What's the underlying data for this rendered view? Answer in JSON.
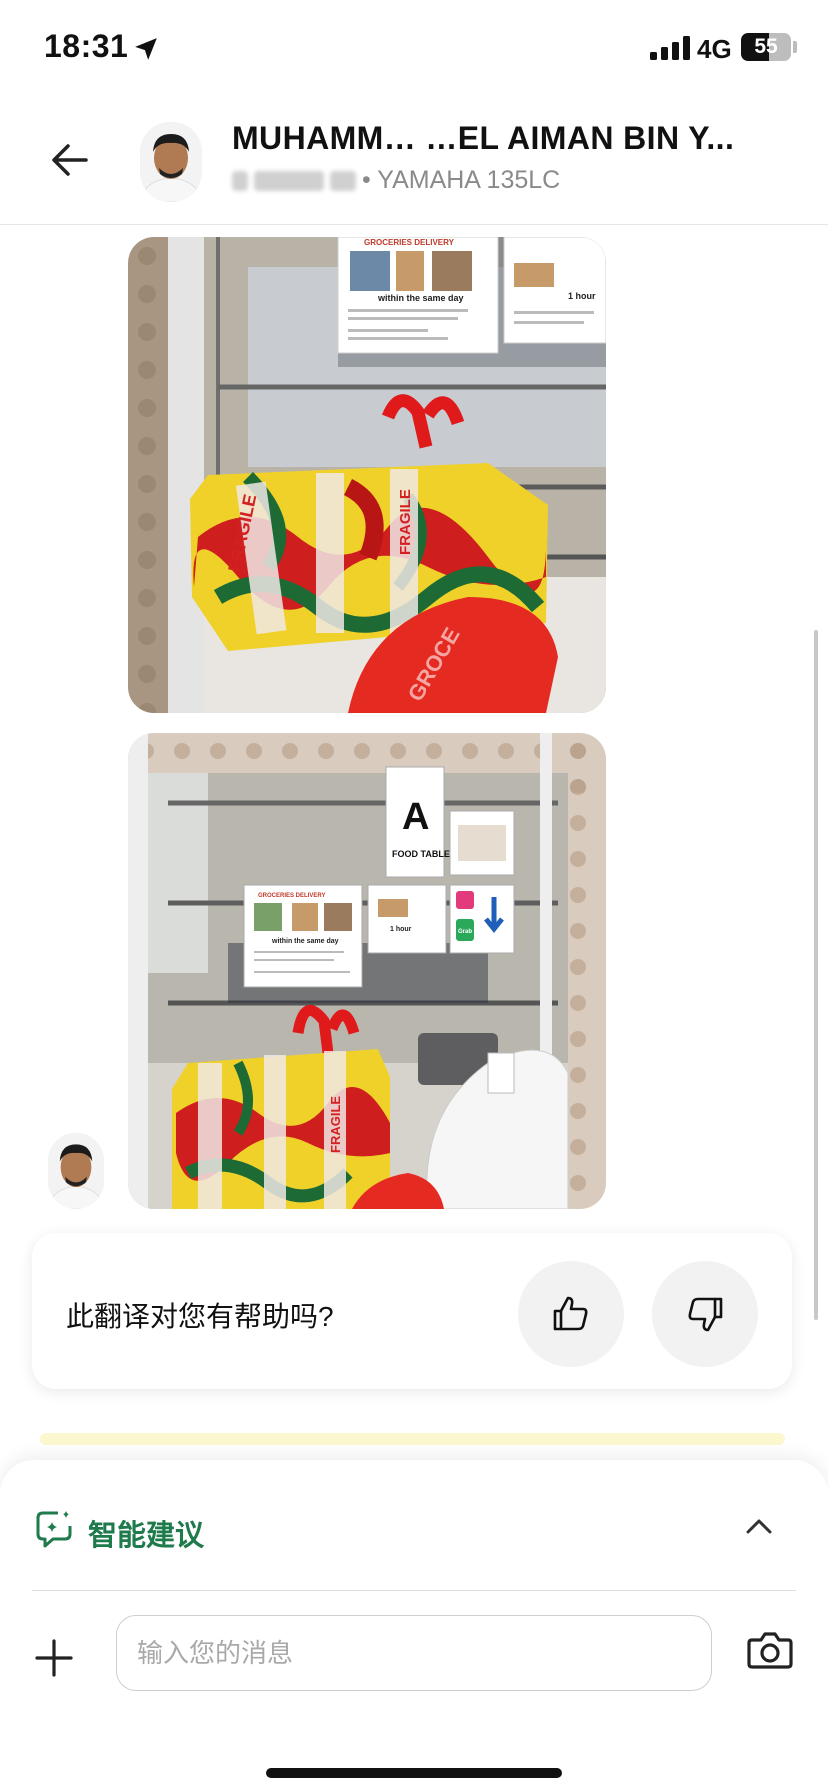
{
  "status_bar": {
    "time": "18:31",
    "network": "4G",
    "battery": "55",
    "battery_level_percent": 55
  },
  "header": {
    "contact_name": "MUHAMM… …EL AIMAN BIN Y...",
    "vehicle": "• YAMAHA 135LC"
  },
  "photos": [
    {
      "sign_title": "GROCERIES DELIVERY",
      "sign_text": "within the same day",
      "sign2_text": "1 hour",
      "label_main": "FRAGILE",
      "bag_text": "GROCE"
    },
    {
      "table_letter": "A",
      "table_text": "FOOD TABLE",
      "sign_title": "GROCERIES DELIVERY",
      "sign_text": "within the same day",
      "sign2_text": "1 hour",
      "grab_text": "Grab",
      "label_main": "FRAGILE"
    }
  ],
  "feedback": {
    "question": "此翻译对您有帮助吗?",
    "up_icon": "thumbs-up-icon",
    "down_icon": "thumbs-down-icon"
  },
  "composer": {
    "suggestions_label": "智能建议",
    "input_placeholder": "输入您的消息"
  },
  "colors": {
    "accent_green": "#1f7a4c",
    "highlight_yellow": "#fbf7cf"
  }
}
